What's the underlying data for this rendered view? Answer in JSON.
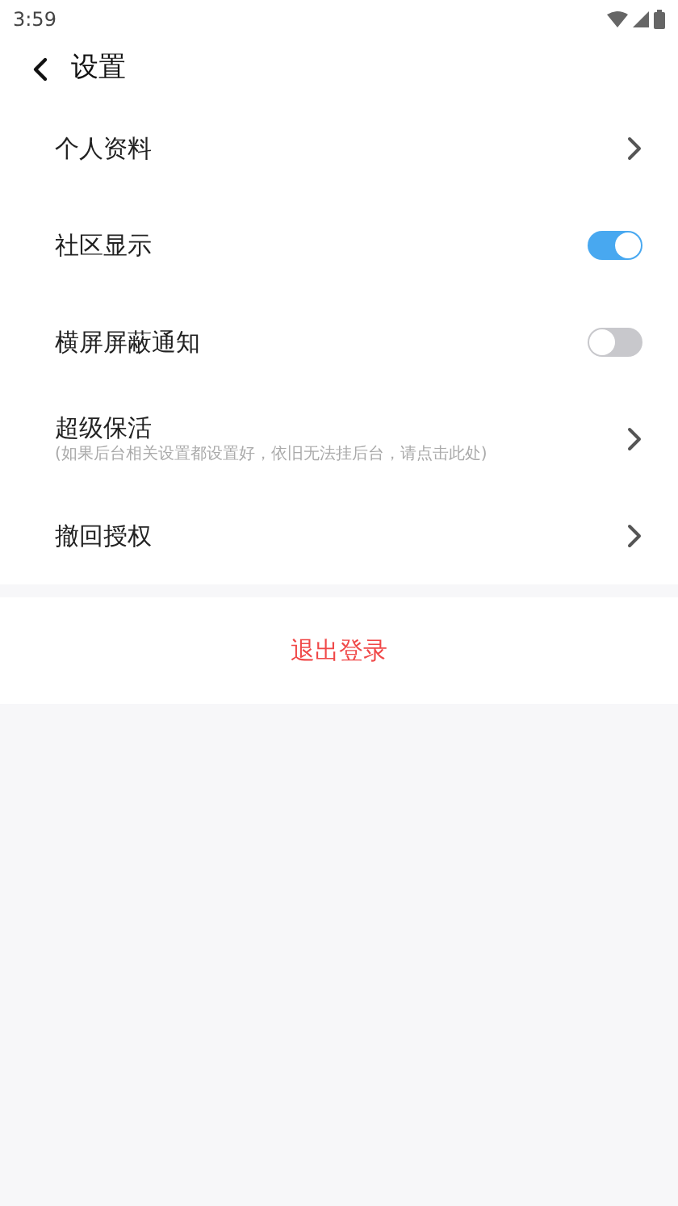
{
  "status_bar": {
    "time": "3:59"
  },
  "header": {
    "title": "设置"
  },
  "settings": [
    {
      "kind": "link",
      "label": "个人资料"
    },
    {
      "kind": "toggle",
      "label": "社区显示",
      "on": true
    },
    {
      "kind": "toggle",
      "label": "横屏屏蔽通知",
      "on": false
    },
    {
      "kind": "link",
      "label": "超级保活",
      "hint": "(如果后台相关设置都设置好，依旧无法挂后台，请点击此处)"
    },
    {
      "kind": "link",
      "label": "撤回授权"
    }
  ],
  "logout_button": {
    "label": "退出登录"
  }
}
